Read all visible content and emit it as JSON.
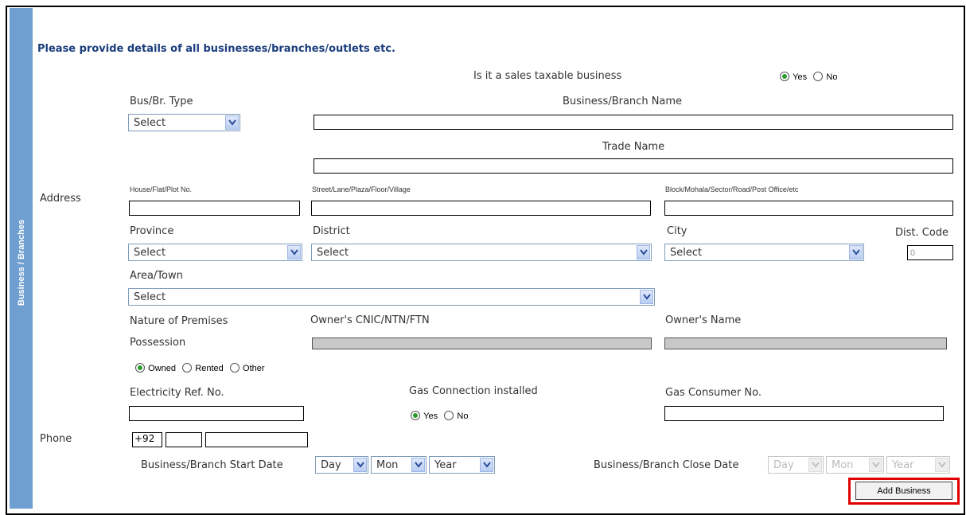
{
  "sidebar": {
    "label": "Business / Branches"
  },
  "heading": "Please provide details of all businesses/branches/outlets etc.",
  "sales_taxable": {
    "label": "Is it a sales taxable business",
    "options": [
      "Yes",
      "No"
    ],
    "selected": "Yes"
  },
  "bus_type": {
    "label": "Bus/Br. Type",
    "value": "Select"
  },
  "business_name": {
    "label": "Business/Branch Name",
    "value": ""
  },
  "trade_name": {
    "label": "Trade Name",
    "value": ""
  },
  "address": {
    "label": "Address",
    "house_label": "House/Flat/Plot No.",
    "street_label": "Street/Lane/Plaza/Floor/Village",
    "block_label": "Block/Mohala/Sector/Road/Post Office/etc"
  },
  "province": {
    "label": "Province",
    "value": "Select"
  },
  "district": {
    "label": "District",
    "value": "Select"
  },
  "city": {
    "label": "City",
    "value": "Select"
  },
  "dist_code": {
    "label": "Dist. Code",
    "value": "0"
  },
  "area": {
    "label": "Area/Town",
    "value": "Select"
  },
  "premises": {
    "label": "Nature of Premises",
    "possession_label": "Possession",
    "options": [
      "Owned",
      "Rented",
      "Other"
    ],
    "selected": "Owned"
  },
  "owner_cnic": {
    "label": "Owner's CNIC/NTN/FTN"
  },
  "owner_name": {
    "label": "Owner's Name"
  },
  "electricity": {
    "label": "Electricity Ref. No."
  },
  "gas": {
    "label": "Gas Connection installed",
    "options": [
      "Yes",
      "No"
    ],
    "selected": "Yes"
  },
  "gas_consumer": {
    "label": "Gas Consumer No."
  },
  "phone": {
    "label": "Phone",
    "country_code": "+92"
  },
  "start_date": {
    "label": "Business/Branch Start Date",
    "day": "Day",
    "month": "Mon",
    "year": "Year"
  },
  "close_date": {
    "label": "Business/Branch Close Date",
    "day": "Day",
    "month": "Mon",
    "year": "Year"
  },
  "add_button": {
    "label": "Add Business"
  },
  "colors": {
    "sidebar": "#6f9fd0",
    "heading": "#1a3d7c",
    "highlight": "#e00000",
    "radio_on": "#2a9b2a"
  }
}
